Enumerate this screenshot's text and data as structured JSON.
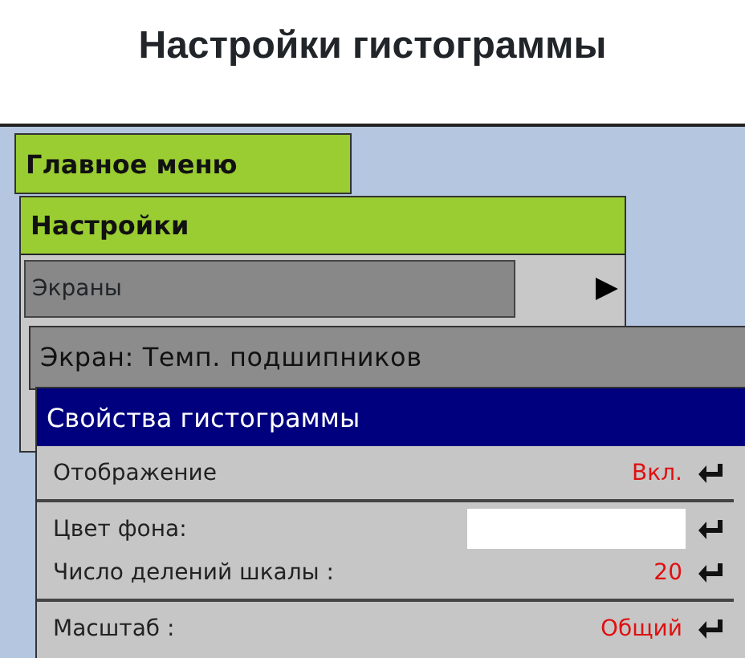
{
  "page_title": "Настройки гистограммы",
  "main_menu": {
    "title": "Главное меню"
  },
  "settings_menu": {
    "title": "Настройки",
    "items": [
      {
        "label": "Экраны",
        "selected": true,
        "submenu": true
      }
    ]
  },
  "screen_window": {
    "title": "Экран: Темп. подшипников"
  },
  "properties": {
    "title": "Свойства гистограммы",
    "sections": [
      [
        {
          "kind": "value",
          "label": "Отображение",
          "value": "Вкл."
        }
      ],
      [
        {
          "kind": "swatch",
          "label": "Цвет фона:",
          "color": "#ffffff"
        },
        {
          "kind": "value",
          "label": "Число делений шкалы :",
          "value": "20"
        }
      ],
      [
        {
          "kind": "value",
          "label": "Масштаб :",
          "value": "Общий"
        }
      ]
    ]
  }
}
